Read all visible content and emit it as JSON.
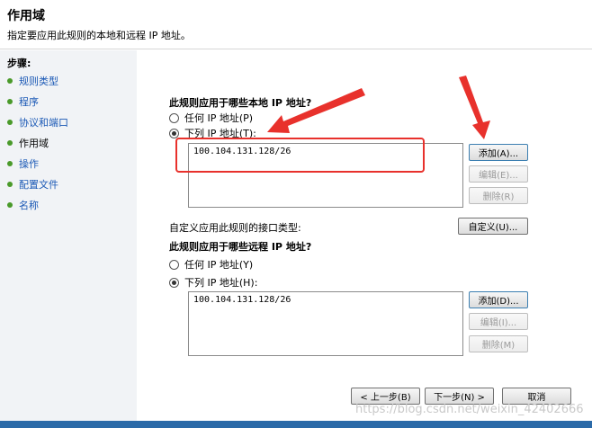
{
  "header": {
    "title": "作用域",
    "subtitle": "指定要应用此规则的本地和远程 IP 地址。"
  },
  "sidebar": {
    "heading": "步骤:",
    "items": [
      {
        "label": "规则类型"
      },
      {
        "label": "程序"
      },
      {
        "label": "协议和端口"
      },
      {
        "label": "作用域"
      },
      {
        "label": "操作"
      },
      {
        "label": "配置文件"
      },
      {
        "label": "名称"
      }
    ]
  },
  "local": {
    "heading": "此规则应用于哪些本地 IP 地址?",
    "any_label": "任何 IP 地址(P)",
    "list_label": "下列 IP 地址(T):",
    "entries": [
      "100.104.131.128/26"
    ],
    "add": "添加(A)...",
    "edit": "编辑(E)...",
    "remove": "删除(R)"
  },
  "interface": {
    "label": "自定义应用此规则的接口类型:",
    "button": "自定义(U)..."
  },
  "remote": {
    "heading": "此规则应用于哪些远程 IP 地址?",
    "any_label": "任何 IP 地址(Y)",
    "list_label": "下列 IP 地址(H):",
    "entries": [
      "100.104.131.128/26"
    ],
    "add": "添加(D)...",
    "edit": "编辑(I)...",
    "remove": "删除(M)"
  },
  "footer": {
    "back": "< 上一步(B)",
    "next": "下一步(N) >",
    "cancel": "取消"
  },
  "watermark": "https://blog.csdn.net/weixin_42402666",
  "colors": {
    "annotation": "#e8312c",
    "link": "#1a58b5",
    "step_bullet": "#4a9a2a"
  }
}
